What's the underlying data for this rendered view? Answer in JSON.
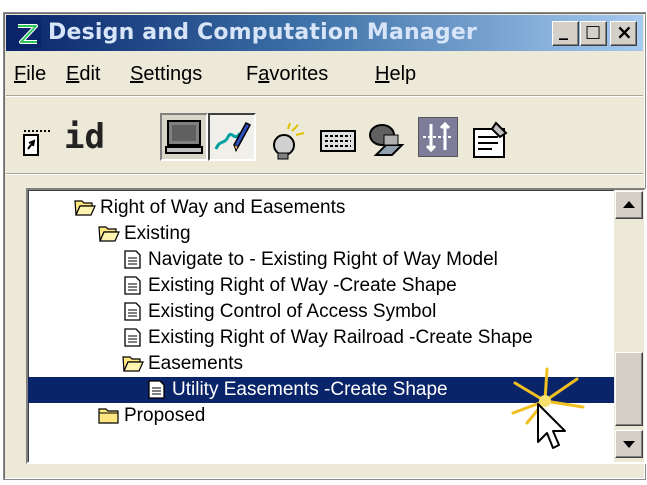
{
  "window": {
    "title": "Design and Computation Manager",
    "min_glyph": "_",
    "max_glyph": "□",
    "close_glyph": "×"
  },
  "menu": [
    {
      "key": "F",
      "rest": "ile"
    },
    {
      "key": "E",
      "rest": "dit"
    },
    {
      "key": "S",
      "rest": "ettings"
    },
    {
      "pre": "F",
      "key": "a",
      "rest": "vorites"
    },
    {
      "key": "H",
      "rest": "elp"
    }
  ],
  "toolbar": {
    "id_label": "id",
    "icons": [
      "place-cell-icon",
      "id-icon",
      "monitor-icon",
      "design-pen-icon",
      "lightbulb-icon",
      "keyboard-icon",
      "tunnel-icon",
      "compass-arrows-icon",
      "dialog-settings-icon"
    ]
  },
  "tree": {
    "items": [
      {
        "label": "Right of Way and Easements",
        "type": "open-folder",
        "level": 1,
        "selected": false
      },
      {
        "label": "Existing",
        "type": "open-folder",
        "level": 2,
        "selected": false
      },
      {
        "label": "Navigate to - Existing Right of Way Model",
        "type": "doc",
        "level": 3,
        "selected": false
      },
      {
        "label": "Existing Right of Way -Create Shape",
        "type": "doc",
        "level": 3,
        "selected": false
      },
      {
        "label": "Existing  Control of Access Symbol",
        "type": "doc",
        "level": 3,
        "selected": false
      },
      {
        "label": "Existing Right of Way Railroad -Create Shape",
        "type": "doc",
        "level": 3,
        "selected": false
      },
      {
        "label": "Easements",
        "type": "open-folder",
        "level": 3,
        "selected": false
      },
      {
        "label": "Utility  Easements -Create Shape",
        "type": "doc",
        "level": 4,
        "selected": true
      },
      {
        "label": "Proposed",
        "type": "closed-folder",
        "level": 2,
        "selected": false
      }
    ]
  },
  "colors": {
    "title_start": "#0a246a",
    "title_end": "#a6caf0",
    "selection": "#0a246a",
    "face": "#ece9d8"
  }
}
